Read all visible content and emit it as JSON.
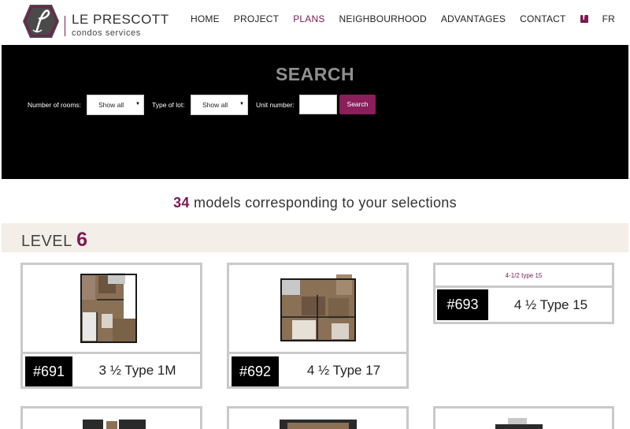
{
  "brand": {
    "name": "LE PRESCOTT",
    "subtitle": "condos services",
    "logo_icon": "prescott-hexagon-logo-icon"
  },
  "nav": {
    "items": [
      {
        "label": "HOME",
        "active": false
      },
      {
        "label": "PROJECT",
        "active": false
      },
      {
        "label": "PLANS",
        "active": true
      },
      {
        "label": "NEIGHBOURHOOD",
        "active": false
      },
      {
        "label": "ADVANTAGES",
        "active": false
      },
      {
        "label": "CONTACT",
        "active": false
      }
    ],
    "social_icon": "facebook-icon",
    "lang": "FR"
  },
  "search": {
    "title": "SEARCH",
    "rooms_label": "Number of rooms:",
    "rooms_value": "Show all",
    "lot_label": "Type of lot:",
    "lot_value": "Show all",
    "unit_label": "Unit number:",
    "unit_value": "",
    "button_label": "Search"
  },
  "results": {
    "count": "34",
    "text": " models corresponding to your selections"
  },
  "level": {
    "label": "LEVEL",
    "number": "6"
  },
  "units": [
    {
      "number": "#691",
      "type": "3 ½ Type 1M"
    },
    {
      "number": "#692",
      "type": "4 ½ Type 17"
    },
    {
      "number": "#693",
      "type": "4 ½ Type 15",
      "tag": "4-1/2 type 15"
    }
  ],
  "colors": {
    "accent": "#7a1a55",
    "search_button": "#8a1f5b",
    "band": "#000000",
    "level_band": "#f3efe8"
  }
}
